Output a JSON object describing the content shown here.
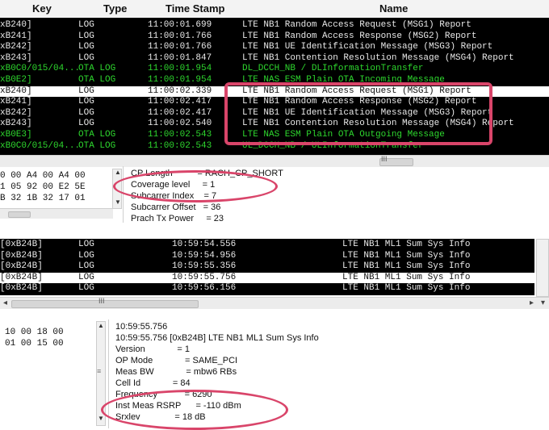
{
  "top": {
    "headers": {
      "key": "Key",
      "type": "Type",
      "time": "Time Stamp",
      "name": "Name"
    },
    "rows": [
      {
        "key": "xB240]",
        "type": "LOG",
        "time": "11:00:01.699",
        "name": "LTE NB1 Random Access Request (MSG1) Report",
        "style": "log"
      },
      {
        "key": "xB241]",
        "type": "LOG",
        "time": "11:00:01.766",
        "name": "LTE NB1 Random Access Response (MSG2) Report",
        "style": "log"
      },
      {
        "key": "xB242]",
        "type": "LOG",
        "time": "11:00:01.766",
        "name": "LTE NB1 UE Identification Message (MSG3) Report",
        "style": "log"
      },
      {
        "key": "xB243]",
        "type": "LOG",
        "time": "11:00:01.847",
        "name": "LTE NB1 Contention Resolution Message (MSG4) Report",
        "style": "log"
      },
      {
        "key": "xB0C0/015/04...",
        "type": "OTA LOG",
        "time": "11:00:01.954",
        "name": "DL_DCCH_NB / DLInformationTransfer",
        "style": "ota"
      },
      {
        "key": "xB0E2]",
        "type": "OTA LOG",
        "time": "11:00:01.954",
        "name": "LTE NAS ESM Plain OTA Incoming Message",
        "style": "ota"
      },
      {
        "key": "xB240]",
        "type": "LOG",
        "time": "11:00:02.339",
        "name": "LTE NB1 Random Access Request (MSG1) Report",
        "style": "sel"
      },
      {
        "key": "xB241]",
        "type": "LOG",
        "time": "11:00:02.417",
        "name": "LTE NB1 Random Access Response (MSG2) Report",
        "style": "log"
      },
      {
        "key": "xB242]",
        "type": "LOG",
        "time": "11:00:02.417",
        "name": "LTE NB1 UE Identification Message (MSG3) Report",
        "style": "log"
      },
      {
        "key": "xB243]",
        "type": "LOG",
        "time": "11:00:02.540",
        "name": "LTE NB1 Contention Resolution Message (MSG4) Report",
        "style": "log"
      },
      {
        "key": "xB0E3]",
        "type": "OTA LOG",
        "time": "11:00:02.543",
        "name": "LTE NAS ESM Plain OTA Outgoing Message",
        "style": "ota"
      },
      {
        "key": "xB0C0/015/04...",
        "type": "OTA LOG",
        "time": "11:00:02.543",
        "name": "UL_DCCH_NB / ULInformationTransfer",
        "style": "ota"
      }
    ],
    "hex": [
      "0 00 A4 00 A4 00",
      "1 05 92 00 E2 5E",
      "B 32 1B 32 17 01"
    ],
    "detail": [
      "CP Length          = RACH_CP_SHORT",
      "Coverage level     = 1",
      "Subcarrer Index    = 7",
      "Subcarrer Offset   = 36",
      "Prach Tx Power     = 23"
    ]
  },
  "bottom": {
    "rows": [
      {
        "key": "[0xB24B]",
        "type": "LOG",
        "time": "10:59:54.556",
        "name": "LTE NB1 ML1 Sum Sys Info",
        "style": "log"
      },
      {
        "key": "[0xB24B]",
        "type": "LOG",
        "time": "10:59:54.956",
        "name": "LTE NB1 ML1 Sum Sys Info",
        "style": "log"
      },
      {
        "key": "[0xB24B]",
        "type": "LOG",
        "time": "10:59:55.356",
        "name": "LTE NB1 ML1 Sum Sys Info",
        "style": "log"
      },
      {
        "key": "[0xB24B]",
        "type": "LOG",
        "time": "10:59:55.756",
        "name": "LTE NB1 ML1 Sum Sys Info",
        "style": "sel"
      },
      {
        "key": "[0xB24B]",
        "type": "LOG",
        "time": "10:59:56.156",
        "name": "LTE NB1 ML1 Sum Sys Info",
        "style": "log"
      }
    ],
    "hex": [
      "10 00 18 00",
      "01 00 15 00"
    ],
    "detail": [
      "10:59:55.756",
      "10:59:55.756 [0xB24B] LTE NB1 ML1 Sum Sys Info",
      "Version             = 1",
      "OP Mode             = SAME_PCI",
      "Meas BW             = mbw6 RBs",
      "Cell Id             = 84",
      "Frequency           = 6290",
      "Inst Meas RSRP      = -110 dBm",
      "Srxlev              = 18 dB"
    ]
  },
  "colors": {
    "highlight": "#d9456a",
    "ota": "#2ed82e",
    "rowbg": "#000000"
  }
}
